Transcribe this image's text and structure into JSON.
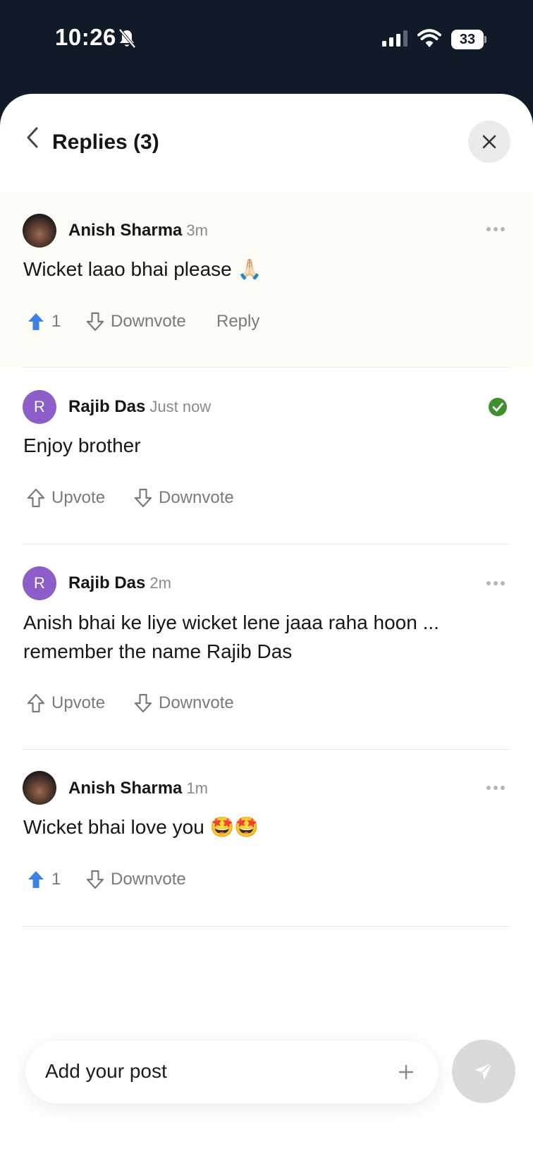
{
  "status_bar": {
    "time": "10:26",
    "battery": "33"
  },
  "header": {
    "title": "Replies (3)"
  },
  "posts": [
    {
      "author": "Anish Sharma",
      "time": "3m",
      "body": "Wicket laao bhai please 🙏🏻",
      "upvote_count": "1",
      "downvote_label": "Downvote",
      "reply_label": "Reply"
    },
    {
      "author": "Rajib Das",
      "avatar_letter": "R",
      "time": "Just now",
      "body": "Enjoy brother",
      "upvote_label": "Upvote",
      "downvote_label": "Downvote"
    },
    {
      "author": "Rajib Das",
      "avatar_letter": "R",
      "time": "2m",
      "body": "Anish bhai ke liye wicket lene jaaa raha hoon ... remember the name Rajib Das",
      "upvote_label": "Upvote",
      "downvote_label": "Downvote"
    },
    {
      "author": "Anish Sharma",
      "time": "1m",
      "body": "Wicket bhai love you 🤩🤩",
      "upvote_count": "1",
      "downvote_label": "Downvote"
    }
  ],
  "composer": {
    "placeholder": "Add your post"
  },
  "colors": {
    "status_bar_bg": "#111a28",
    "upvoted_blue": "#3b82e6",
    "avatar_purple": "#8d5ec9",
    "verified_green": "#3f8f2f",
    "highlight_bg": "#fcfbf5"
  }
}
